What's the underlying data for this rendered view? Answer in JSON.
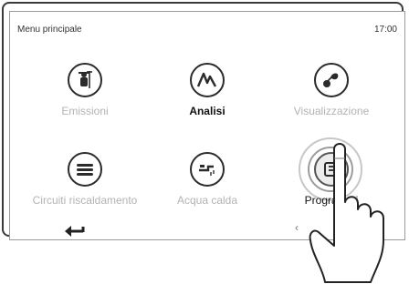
{
  "header": {
    "title": "Menu principale",
    "time": "17:00"
  },
  "menu": {
    "items": [
      {
        "label": "Emissioni",
        "icon": "chimney-sweep-icon",
        "state": "disabled"
      },
      {
        "label": "Analisi",
        "icon": "analysis-graph-icon",
        "state": "active"
      },
      {
        "label": "Visualizzazione",
        "icon": "fan-sensor-icon",
        "state": "disabled"
      },
      {
        "label": "Circuiti riscaldamento",
        "icon": "radiator-icon",
        "state": "disabled"
      },
      {
        "label": "Acqua calda",
        "icon": "tap-water-icon",
        "state": "disabled"
      },
      {
        "label": "Programmi",
        "icon": "programs-icon",
        "state": "pressed"
      }
    ]
  },
  "nav": {
    "back_icon": "back-arrow-icon",
    "prev_icon": "chevron-left-icon",
    "prev_glyph": "‹"
  },
  "colors": {
    "disabled_text": "#b3b3b3",
    "active_text": "#111111",
    "halo": "#c7c7c7"
  }
}
